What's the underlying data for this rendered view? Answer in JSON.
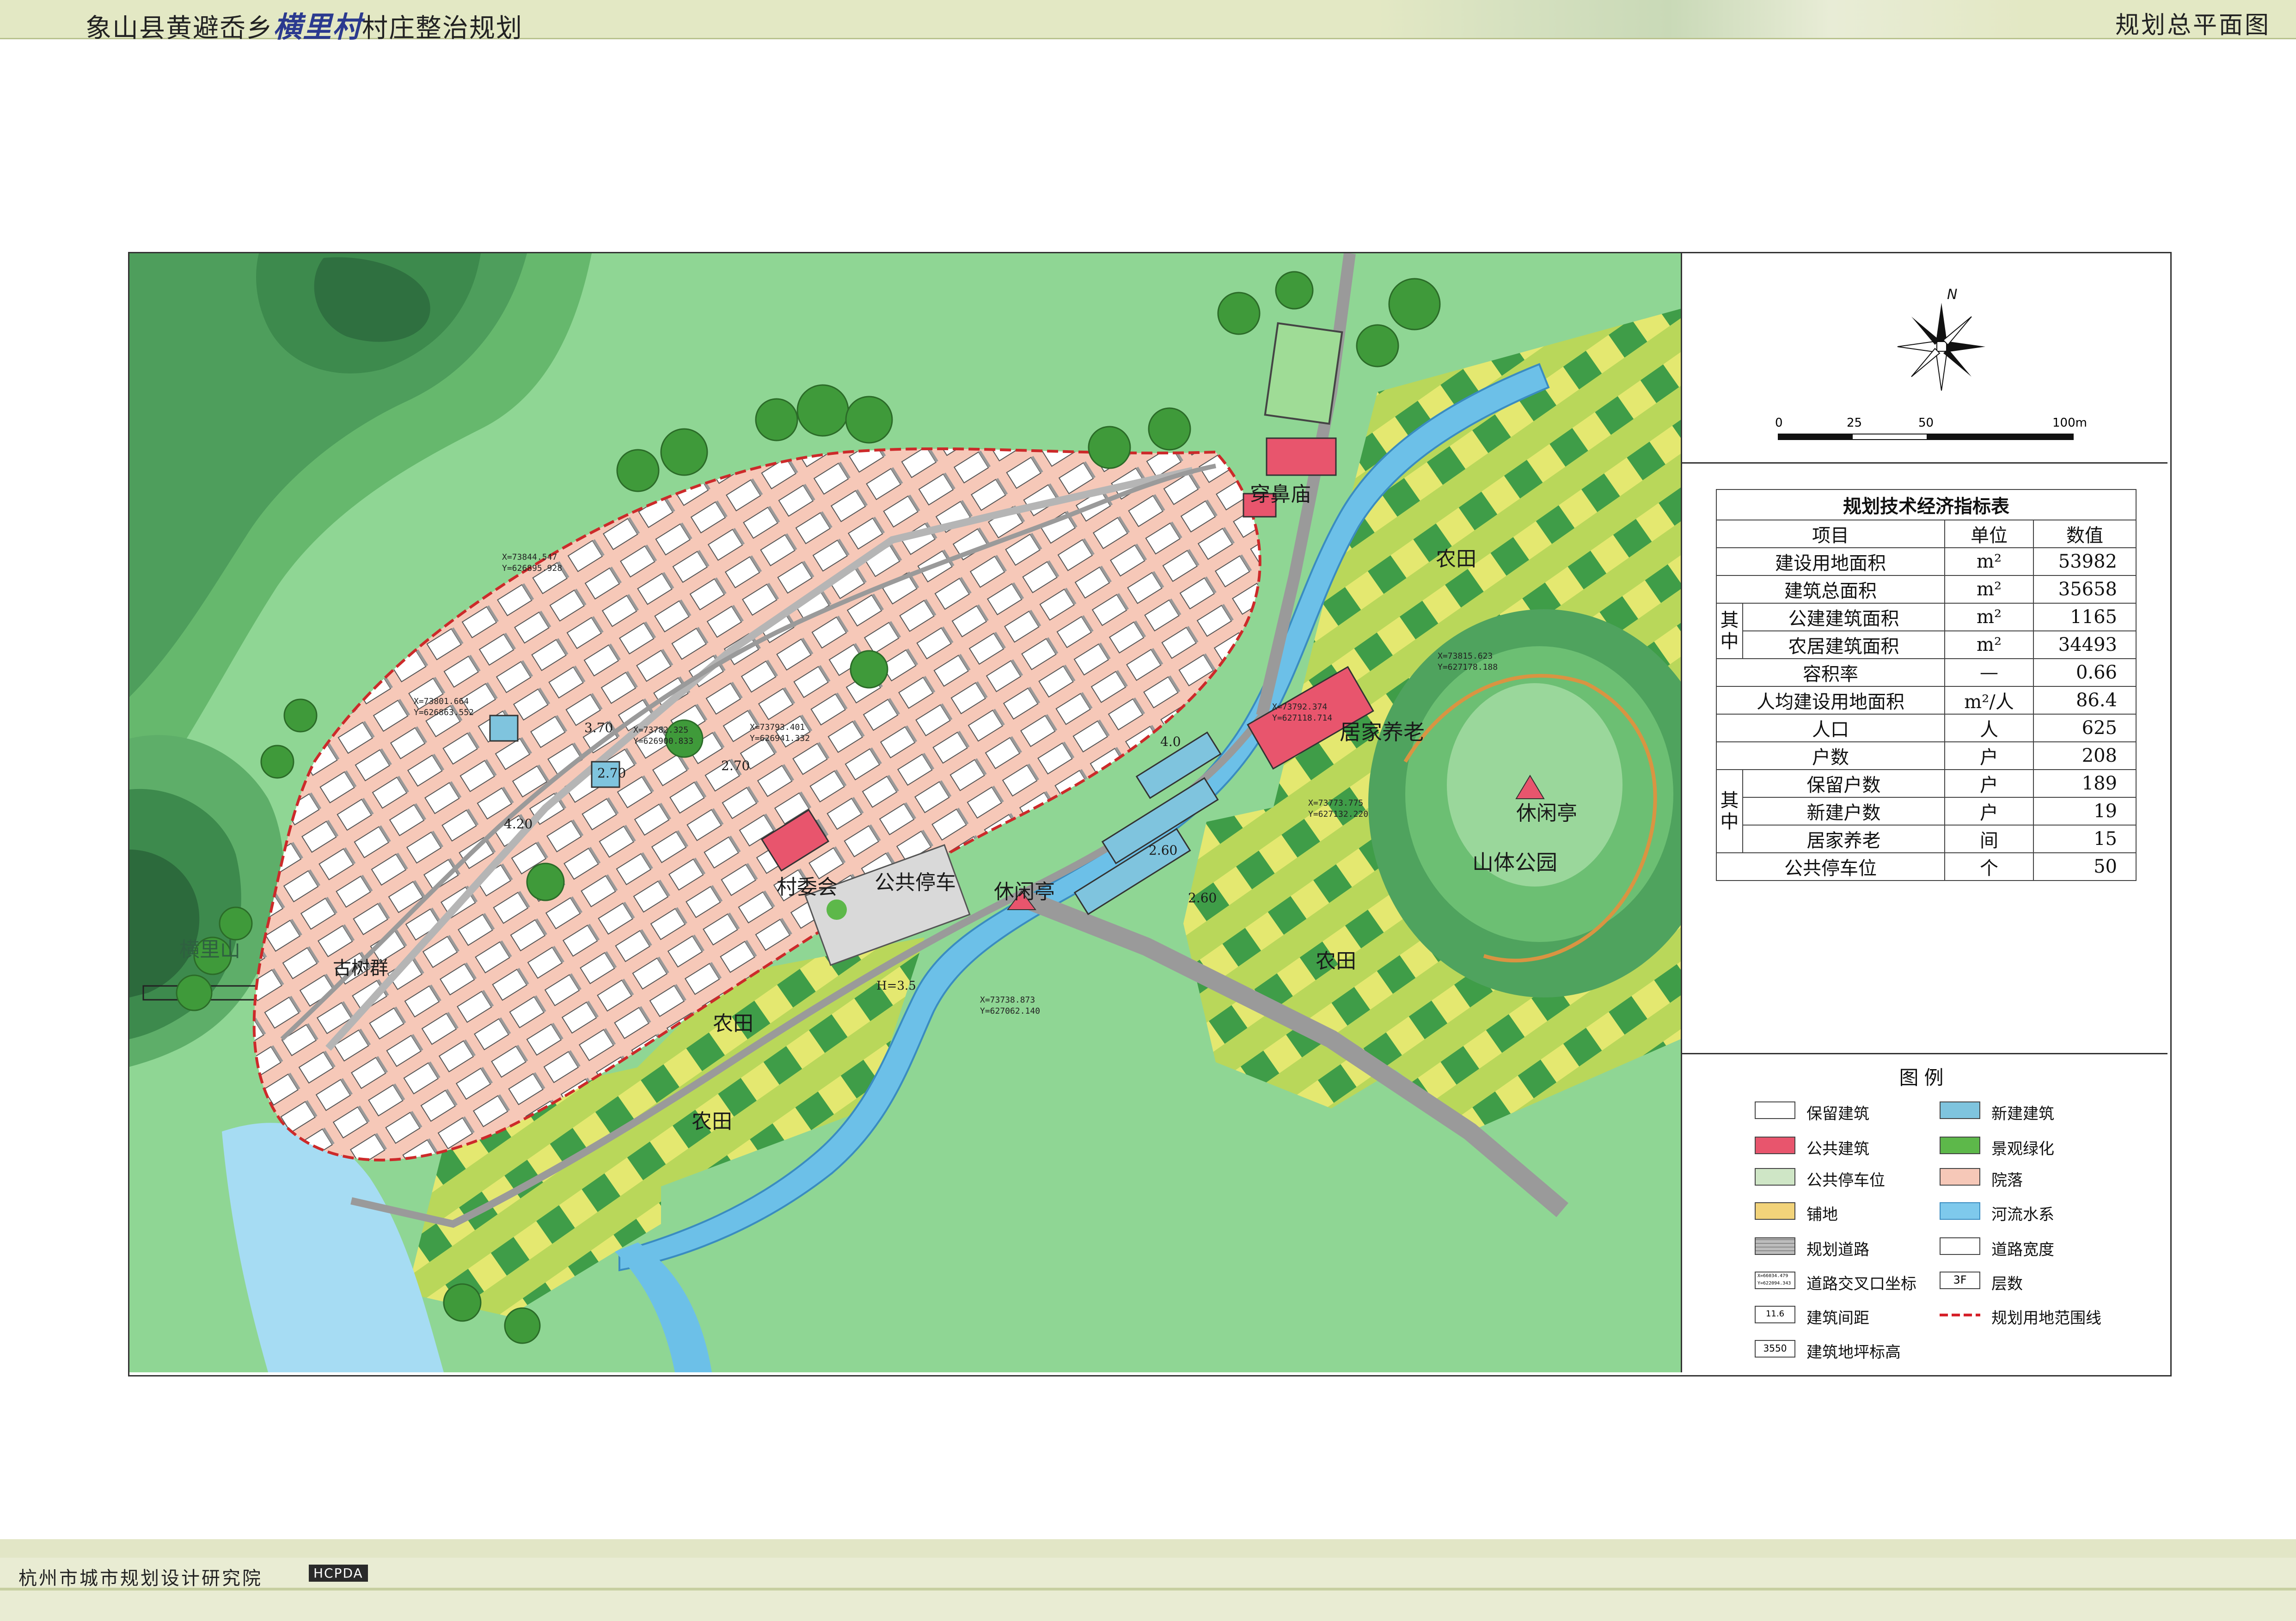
{
  "header": {
    "title_prefix": "象山县黄避岙乡",
    "title_village": "横里村",
    "title_suffix": "村庄整治规划",
    "sheet_name": "规划总平面图"
  },
  "footer": {
    "organization": "杭州市城市规划设计研究院",
    "logo": "HCPDA"
  },
  "compass": {
    "north": "N"
  },
  "scale_bar": {
    "ticks": [
      "0",
      "25",
      "50",
      "100m"
    ]
  },
  "map_labels": {
    "mountain": "横里山",
    "ancient_trees": "古树群",
    "village_committee": "村委会",
    "public_parking": "公共停车",
    "pavilion_1": "休闲亭",
    "pavilion_2": "休闲亭",
    "temple": "穿鼻庙",
    "elderly_care": "居家养老",
    "mountain_park": "山体公园",
    "farmland_1": "农田",
    "farmland_2": "农田",
    "farmland_3": "农田",
    "farmland_4": "农田",
    "road_width_1": "4.0",
    "road_width_2": "2.60",
    "road_width_3": "2.60",
    "road_width_4": "3.70",
    "road_width_5": "2.70",
    "road_width_6": "2.70",
    "road_width_7": "4.20",
    "bridge": "H=3.5"
  },
  "coordinates": [
    {
      "x": "X=73844.547",
      "y": "Y=626895.928"
    },
    {
      "x": "X=73801.664",
      "y": "Y=626863.552"
    },
    {
      "x": "X=73782.325",
      "y": "Y=626900.833"
    },
    {
      "x": "X=73793.401",
      "y": "Y=626941.332"
    },
    {
      "x": "X=73815.623",
      "y": "Y=627178.188"
    },
    {
      "x": "X=73792.374",
      "y": "Y=627118.714"
    },
    {
      "x": "X=73773.775",
      "y": "Y=627132.220"
    },
    {
      "x": "X=73738.873",
      "y": "Y=627062.140"
    }
  ],
  "indicator_table": {
    "title": "规划技术经济指标表",
    "headers": [
      "项目",
      "单位",
      "数值"
    ],
    "group_label": "其中",
    "rows": [
      {
        "item": "建设用地面积",
        "unit": "m²",
        "value": "53982"
      },
      {
        "item": "建筑总面积",
        "unit": "m²",
        "value": "35658"
      },
      {
        "item": "公建建筑面积",
        "unit": "m²",
        "value": "1165"
      },
      {
        "item": "农居建筑面积",
        "unit": "m²",
        "value": "34493"
      },
      {
        "item": "容积率",
        "unit": "—",
        "value": "0.66"
      },
      {
        "item": "人均建设用地面积",
        "unit": "m²/人",
        "value": "86.4"
      },
      {
        "item": "人口",
        "unit": "人",
        "value": "625"
      },
      {
        "item": "户数",
        "unit": "户",
        "value": "208"
      },
      {
        "item": "保留户数",
        "unit": "户",
        "value": "189"
      },
      {
        "item": "新建户数",
        "unit": "户",
        "value": "19"
      },
      {
        "item": "居家养老",
        "unit": "间",
        "value": "15"
      },
      {
        "item": "公共停车位",
        "unit": "个",
        "value": "50"
      }
    ]
  },
  "legend": {
    "title": "图例",
    "items": [
      {
        "label": "保留建筑",
        "color": "#ffffff"
      },
      {
        "label": "新建建筑",
        "color": "#7fc4de"
      },
      {
        "label": "公共建筑",
        "color": "#e8556d"
      },
      {
        "label": "景观绿化",
        "color": "#5db84a"
      },
      {
        "label": "公共停车位",
        "color": "#cfe6c6"
      },
      {
        "label": "院落",
        "color": "#f6c8b8"
      },
      {
        "label": "铺地",
        "color": "#f2d37a"
      },
      {
        "label": "河流水系",
        "color": "#7ec9ec"
      },
      {
        "label": "规划道路",
        "color": "#bdbdbd"
      },
      {
        "label": "道路宽度",
        "color": "#ffffff"
      },
      {
        "label": "道路交叉口坐标",
        "color": "#ffffff"
      },
      {
        "label": "层数",
        "color": "#ffffff"
      },
      {
        "label": "建筑间距",
        "color": "#ffffff"
      },
      {
        "label": "规划用地范围线",
        "color": "#d6212a"
      },
      {
        "label": "建筑地坪标高",
        "color": "#ffffff"
      }
    ],
    "samples": {
      "coord_1": "X=66034.479",
      "coord_2": "Y=622094.343",
      "spacing": "11.6",
      "floors": "3F",
      "elevation": "3550"
    }
  }
}
